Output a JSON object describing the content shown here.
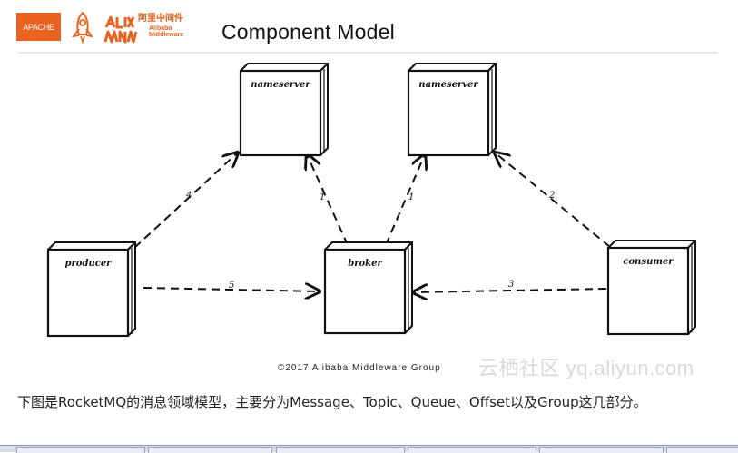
{
  "header": {
    "apache_logo_text": "APACHE",
    "alibaba_logo_cn": "阿里中间件",
    "alibaba_logo_en": "Alibaba Middleware",
    "title": "Component Model"
  },
  "diagram": {
    "nodes": [
      {
        "id": "nameserver1",
        "label": "nameserver"
      },
      {
        "id": "nameserver2",
        "label": "nameserver"
      },
      {
        "id": "producer",
        "label": "producer"
      },
      {
        "id": "broker",
        "label": "broker"
      },
      {
        "id": "consumer",
        "label": "consumer"
      }
    ],
    "edges": [
      {
        "from": "producer",
        "to": "nameserver1",
        "label": "4"
      },
      {
        "from": "broker",
        "to": "nameserver1",
        "label": "1"
      },
      {
        "from": "broker",
        "to": "nameserver2",
        "label": "1"
      },
      {
        "from": "consumer",
        "to": "nameserver2",
        "label": "2"
      },
      {
        "from": "producer",
        "to": "broker",
        "label": "5"
      },
      {
        "from": "consumer",
        "to": "broker",
        "label": "3"
      }
    ],
    "copyright": "©2017 Alibaba Middleware Group",
    "watermark": "云栖社区 yq.aliyun.com"
  },
  "caption": "下图是RocketMQ的消息领域模型，主要分为Message、Topic、Queue、Offset以及Group这几部分。",
  "colors": {
    "accent": "#e9621f",
    "ink": "#111111"
  }
}
